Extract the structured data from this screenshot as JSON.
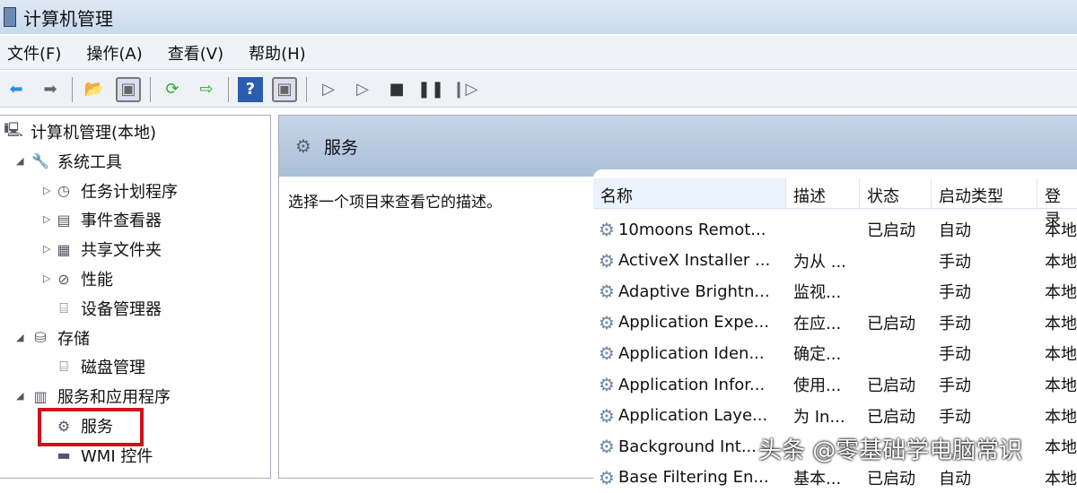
{
  "window": {
    "title": "计算机管理"
  },
  "menu": [
    "文件(F)",
    "操作(A)",
    "查看(V)",
    "帮助(H)"
  ],
  "tree": [
    {
      "label": "计算机管理(本地)",
      "level": 0,
      "icon": "computer-icon"
    },
    {
      "label": "系统工具",
      "level": 1,
      "icon": "tools-icon",
      "expander": "◢"
    },
    {
      "label": "任务计划程序",
      "level": 2,
      "icon": "clock-icon",
      "expander": "▷"
    },
    {
      "label": "事件查看器",
      "level": 2,
      "icon": "event-viewer-icon",
      "expander": "▷"
    },
    {
      "label": "共享文件夹",
      "level": 2,
      "icon": "shared-folder-icon",
      "expander": "▷"
    },
    {
      "label": "性能",
      "level": 2,
      "icon": "performance-icon",
      "expander": "▷"
    },
    {
      "label": "设备管理器",
      "level": 2,
      "icon": "device-manager-icon"
    },
    {
      "label": "存储",
      "level": 1,
      "icon": "storage-icon",
      "expander": "◢"
    },
    {
      "label": "磁盘管理",
      "level": 2,
      "icon": "disk-icon"
    },
    {
      "label": "服务和应用程序",
      "level": 1,
      "icon": "services-apps-icon",
      "expander": "◢"
    },
    {
      "label": "服务",
      "level": 2,
      "icon": "gear-icon"
    },
    {
      "label": "WMI 控件",
      "level": 2,
      "icon": "wmi-icon"
    }
  ],
  "panel": {
    "title": "服务",
    "description": "选择一个项目来查看它的描述。"
  },
  "columns": [
    "名称",
    "描述",
    "状态",
    "启动类型",
    "登录"
  ],
  "rows": [
    [
      "10moons Remot...",
      "",
      "已启动",
      "自动",
      "本地"
    ],
    [
      "ActiveX Installer ...",
      "为从 ...",
      "",
      "手动",
      "本地"
    ],
    [
      "Adaptive Brightn...",
      "监视...",
      "",
      "手动",
      "本地"
    ],
    [
      "Application Expe...",
      "在应...",
      "已启动",
      "手动",
      "本地"
    ],
    [
      "Application Iden...",
      "确定...",
      "",
      "手动",
      "本地"
    ],
    [
      "Application Infor...",
      "使用...",
      "已启动",
      "手动",
      "本地"
    ],
    [
      "Application Laye...",
      "为 In...",
      "已启动",
      "手动",
      "本地"
    ],
    [
      "Background Int...",
      "",
      "",
      "",
      "本地"
    ],
    [
      "Base Filtering En...",
      "基本...",
      "已启动",
      "自动",
      "本地"
    ]
  ],
  "watermark": "头条 @零基础学电脑常识"
}
